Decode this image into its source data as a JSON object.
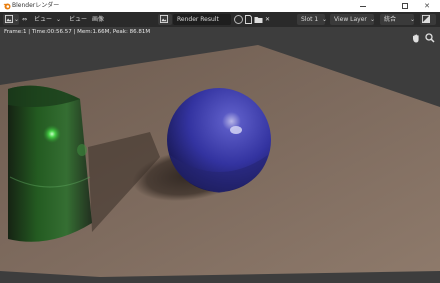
{
  "window": {
    "title": "Blenderレンダー",
    "controls": {
      "minimize_icon": "minimize-icon",
      "maximize_icon": "maximize-icon",
      "close_label": "✕"
    }
  },
  "header": {
    "editor_type_icon": "image-editor-icon",
    "menus": [
      "ビュー",
      "ビュー",
      "画像"
    ],
    "image_browse_icon": "image-browse-icon",
    "image_name": "Render Result",
    "slot_label": "Slot 1",
    "view_layer_label": "View Layer",
    "pass_label": "統合",
    "display_channels_icon": "display-channels-icon"
  },
  "viewport": {
    "info_text": "Frame:1 | Time:00:56.57 | Mem:1.66M, Peak: 86.81M",
    "pan_icon": "hand-pan-icon",
    "zoom_icon": "zoom-icon"
  },
  "colors": {
    "header_bg": "#2a2a2a",
    "floor": "#7a6a5e",
    "background": "#3d3d3d",
    "sphere": "#3a3aa8",
    "glass": "#1f6b1f"
  }
}
